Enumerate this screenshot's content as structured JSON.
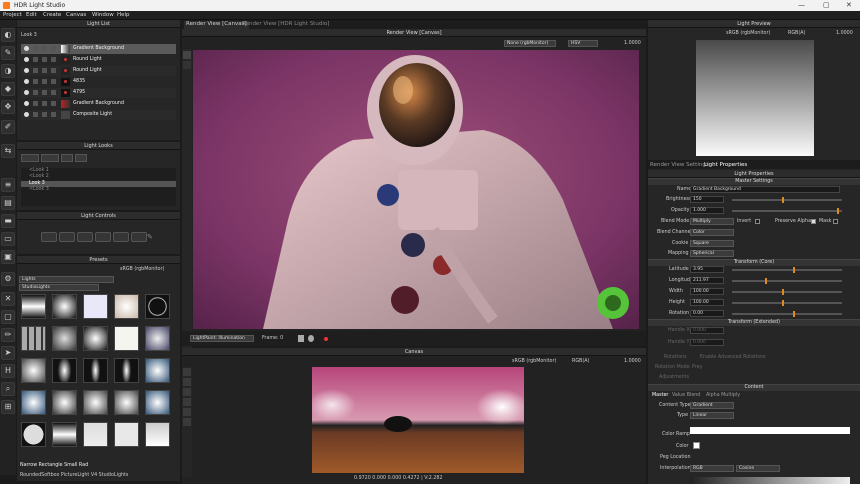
{
  "window": {
    "title": "HDR Light Studio",
    "min": "—",
    "max": "▢",
    "close": "✕"
  },
  "menu": [
    "Project",
    "Edit",
    "Create",
    "Canvas",
    "Window",
    "Help"
  ],
  "light_list": {
    "title": "Light List",
    "look": "Look 3",
    "items": [
      "Gradient Background",
      "Round Light",
      "Round Light",
      "4835",
      "4795",
      "Gradient Background",
      "Composite Light"
    ]
  },
  "light_looks": {
    "title": "Light Looks",
    "items": [
      "<Look 1",
      "<Look 2",
      "Look 3",
      "<Look 3"
    ]
  },
  "light_controls": {
    "title": "Light Controls"
  },
  "presets": {
    "title": "Presets",
    "color_space": "sRGB (rgbMonitor)",
    "category": "Lights",
    "subcategory": "StudioLights",
    "hover_name": "Narrow Rectangle Small Rad",
    "path": "RoundedSoftbox PictureLight V4 StudioLights"
  },
  "render_view": {
    "tab1": "Render View [Canvas]",
    "tab2": "Render View [HDR Light Studio]",
    "title": "Render View [Canvas]",
    "tone": "None (rgbMonitor)",
    "mode": "HSV",
    "value": "1.0000",
    "illum": "LightPaint: Illumination",
    "frame": "Frame: 0"
  },
  "canvas": {
    "title": "Canvas",
    "color_space": "sRGB (rgbMonitor)",
    "channel": "RGB(A)",
    "value": "1.0000",
    "readout": "0.9720 0.000 0.000 0.4272 | V:2.282"
  },
  "light_preview": {
    "title": "Light Preview",
    "color_space": "sRGB (rgbMonitor)",
    "channel": "RGB(A)",
    "value": "1.0000"
  },
  "props": {
    "tab1": "Render View Settings",
    "tab2": "Light Properties",
    "title": "Light Properties",
    "master": "Master Settings",
    "name_label": "Name",
    "name": "Gradient Background",
    "brightness_label": "Brightness",
    "brightness": "150",
    "opacity_label": "Opacity",
    "opacity": "1.000",
    "blend_label": "Blend Mode",
    "blend": "Multiply",
    "invert": "Invert",
    "preserve": "Preserve Alpha",
    "mask": "Mask",
    "channel_label": "Blend Channel",
    "channel": "Color",
    "cookie_label": "Cookie",
    "cookie": "Square",
    "mapping_label": "Mapping",
    "mapping": "Spherical",
    "transform_core": "Transform (Core)",
    "lat_label": "Latitude",
    "lat": "3.95",
    "lon_label": "Longitude",
    "lon": "211.97",
    "width_label": "Width",
    "width": "100.00",
    "height_label": "Height",
    "height": "100.00",
    "rot_label": "Rotation",
    "rot": "0.00",
    "transform_ext": "Transform (Extended)",
    "handle_x": "Handle X",
    "handle_y": "Handle Y",
    "hx": "0.000",
    "hy": "0.000",
    "rotations": "Rotations",
    "enable_adv": "Enable Advanced Rotations",
    "rot_mode": "Rotation Mode",
    "rot_mode_val": "Prey",
    "adjust": "Adjustments",
    "content": "Content",
    "ctabs": [
      "Master",
      "Value Blend",
      "Alpha Multiply"
    ],
    "ctype_label": "Content Type",
    "ctype": "Gradient",
    "type_label": "Type",
    "type": "Linear",
    "ramp_label": "Color Ramp",
    "color_label": "Color",
    "peg_label": "Peg Location",
    "interp_label": "Interpolation",
    "interp": "RGB",
    "interp2": "Cosine"
  }
}
